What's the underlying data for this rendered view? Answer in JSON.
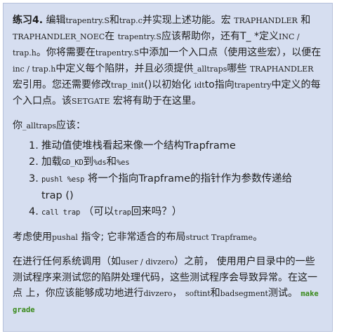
{
  "exercise": {
    "label": "练习4.",
    "p1": "编辑",
    "file_s": "trapentry.S",
    "p2": "和",
    "file_c": "trap.c",
    "p3": "并实现上述功能。宏 ",
    "macro1": "TRAPHANDLER",
    "p4": "和",
    "macro2": "TRAPHANDLER_NOEC",
    "p5": "在 ",
    "file_s2": "trapentry.S",
    "p6": "应该帮助你，还有T_ *定义",
    "inc": "INC /",
    "trap_h": "trap.h",
    "p7": "。你将需要在",
    "file_s3": "trapentry.S",
    "p8": "中添加一个入口点（使用这些宏），以便在",
    "inc2": "inc / trap.h",
    "p9": "中定义每个陷阱，并且必须提供",
    "alltraps": "_alltraps",
    "p10": "哪些 ",
    "macro3": "TRAPHANDLER",
    "p11": "宏引用。您还需要修改",
    "trap_init": "trap_init",
    "p12": "()以初始化 ",
    "idt": "idt",
    "p13": "to指向",
    "file_s4": "trapentry",
    "p14": "中定义的每个入口点。该",
    "setgate": "SETGATE",
    "p15": " 宏将有助于在这里。"
  },
  "alltraps_intro": {
    "prefix": "你",
    "code": "_alltraps",
    "suffix": "应该："
  },
  "steps": [
    {
      "num": "1.",
      "text": "推动值使堆栈看起来像一个结构Trapframe"
    },
    {
      "num": "2.",
      "pre": "加载",
      "code1": "GD_KD",
      "mid": "到",
      "code2": "%ds",
      "and": "和",
      "code3": "%es"
    },
    {
      "num": "3.",
      "code": "pushl %esp",
      "text": " 将一个指向Trapframe的指针作为参数传递给",
      "cont": "trap ()"
    },
    {
      "num": "4.",
      "code": "call trap",
      "text": " （可以",
      "code2": "trap",
      "text2": "回来吗？）"
    }
  ],
  "consider": {
    "pre": "考虑使用",
    "code1": "pushal",
    "mid": " 指令; 它非常适合的布局",
    "code2": "struct Trapframe",
    "post": "。"
  },
  "test": {
    "p1": "在进行任何系统调用（如",
    "code1": "user / divzero",
    "p2": "）之前， 使用用户目录中的一些测试程序来测试您的陷阱处理代码，这些测试程序会导致异常。在这一点 上，你应该能够成功地进行",
    "code2": "divzero",
    "p3": "，",
    "code3": "softint",
    "p4": "和",
    "code4": "badsegment",
    "p5": "测试。",
    "command": "make grade"
  }
}
